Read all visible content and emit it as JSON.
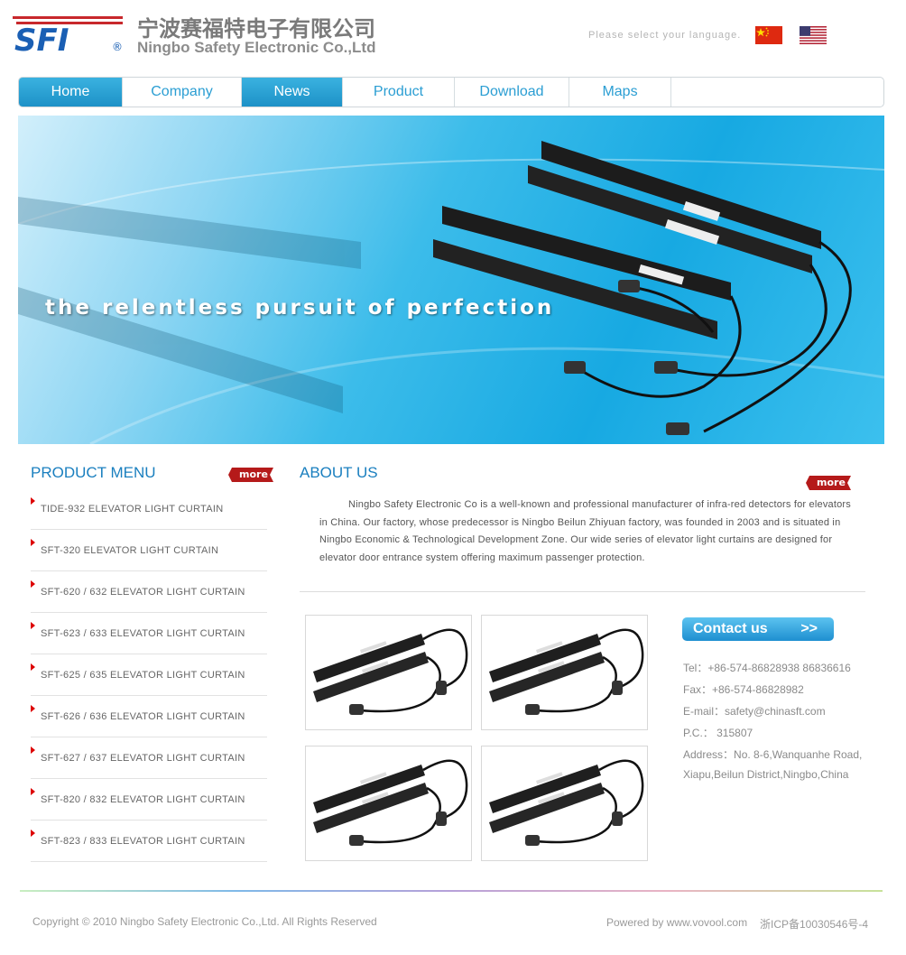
{
  "header": {
    "logo_text": "SFI",
    "company_cn": "宁波赛福特电子有限公司",
    "company_en": "Ningbo Safety Electronic Co.,Ltd",
    "language_prompt": "Please select your language.",
    "flags": [
      "china-flag",
      "usa-flag"
    ]
  },
  "nav": {
    "items": [
      {
        "label": "Home",
        "active": true
      },
      {
        "label": "Company",
        "active": false
      },
      {
        "label": "News",
        "active": true
      },
      {
        "label": "Product",
        "active": false
      },
      {
        "label": "Download",
        "active": false
      },
      {
        "label": "Maps",
        "active": false
      }
    ]
  },
  "banner": {
    "slogan": "the relentless pursuit of perfection"
  },
  "product_menu": {
    "title": "PRODUCT MENU",
    "more_label": "more",
    "items": [
      "TIDE-932 ELEVATOR LIGHT CURTAIN",
      "SFT-320 ELEVATOR LIGHT CURTAIN",
      "SFT-620 / 632 ELEVATOR LIGHT CURTAIN",
      "SFT-623 / 633 ELEVATOR LIGHT CURTAIN",
      "SFT-625 / 635 ELEVATOR LIGHT CURTAIN",
      "SFT-626 / 636 ELEVATOR LIGHT CURTAIN",
      "SFT-627 / 637 ELEVATOR LIGHT CURTAIN",
      "SFT-820 / 832 ELEVATOR LIGHT CURTAIN",
      "SFT-823 / 833 ELEVATOR LIGHT CURTAIN"
    ]
  },
  "about": {
    "title": "ABOUT US",
    "more_label": "more",
    "text": "Ningbo Safety Electronic Co is a well-known and professional manufacturer of infra-red detectors for elevators in China. Our factory, whose predecessor is Ningbo Beilun Zhiyuan factory, was founded in 2003 and is situated in Ningbo Economic & Technological Development Zone. Our wide series of elevator light curtains are designed for elevator door entrance system offering maximum passenger protection."
  },
  "contact": {
    "button_label": "Contact us",
    "button_chevron": ">>",
    "tel": "Tel：+86-574-86828938 86836616",
    "fax": "Fax：+86-574-86828982",
    "email": "E-mail：safety@chinasft.com",
    "postcode": "P.C.： 315807",
    "address_line1": "Address：No. 8-6,Wanquanhe Road,",
    "address_line2": "Xiapu,Beilun District,Ningbo,China"
  },
  "footer": {
    "copyright": "Copyright © 2010 Ningbo Safety Electronic Co.,Ltd. All Rights Reserved",
    "powered": "Powered by www.vovool.com",
    "icp": "浙ICP备10030546号-4"
  },
  "colors": {
    "accent_blue": "#2b9ed3",
    "title_blue": "#1a7fbf",
    "more_red": "#b51a1a"
  }
}
